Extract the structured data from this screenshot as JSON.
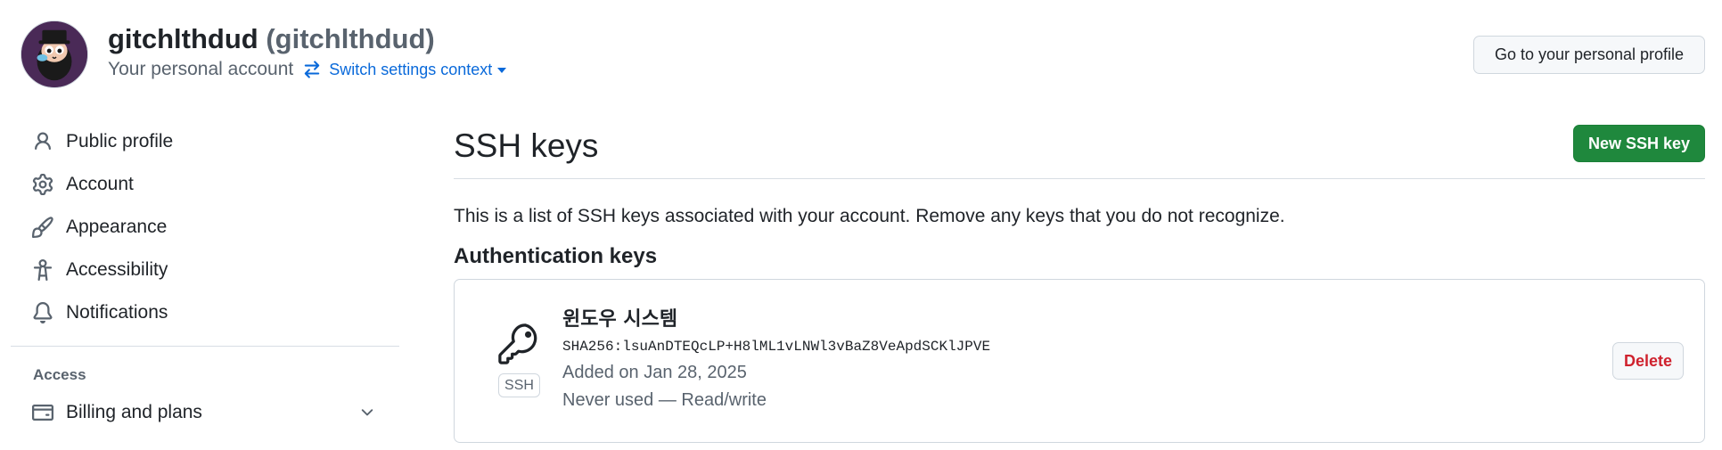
{
  "header": {
    "user_display_name": "gitchlthdud",
    "user_login": "(gitchlthdud)",
    "account_type": "Your personal account",
    "switch_context_label": "Switch settings context",
    "profile_button_label": "Go to your personal profile"
  },
  "sidebar": {
    "items": [
      {
        "label": "Public profile",
        "icon": "person-icon"
      },
      {
        "label": "Account",
        "icon": "gear-icon"
      },
      {
        "label": "Appearance",
        "icon": "paintbrush-icon"
      },
      {
        "label": "Accessibility",
        "icon": "accessibility-icon"
      },
      {
        "label": "Notifications",
        "icon": "bell-icon"
      }
    ],
    "section_access": "Access",
    "access_items": [
      {
        "label": "Billing and plans",
        "icon": "credit-card-icon"
      }
    ]
  },
  "main": {
    "title": "SSH keys",
    "new_key_button": "New SSH key",
    "description": "This is a list of SSH keys associated with your account. Remove any keys that you do not recognize.",
    "auth_heading": "Authentication keys",
    "keys": [
      {
        "name": "윈도우 시스템",
        "fingerprint": "SHA256:lsuAnDTEQcLP+H8lML1vLNWl3vBaZ8VeApdSCKlJPVE",
        "added": "Added on Jan 28, 2025",
        "usage": "Never used — Read/write",
        "badge": "SSH",
        "delete_label": "Delete"
      }
    ]
  },
  "colors": {
    "link": "#0969da",
    "primary_button": "#1f883d",
    "danger": "#cf222e",
    "muted_text": "#59636e",
    "border": "#d0d7de"
  }
}
